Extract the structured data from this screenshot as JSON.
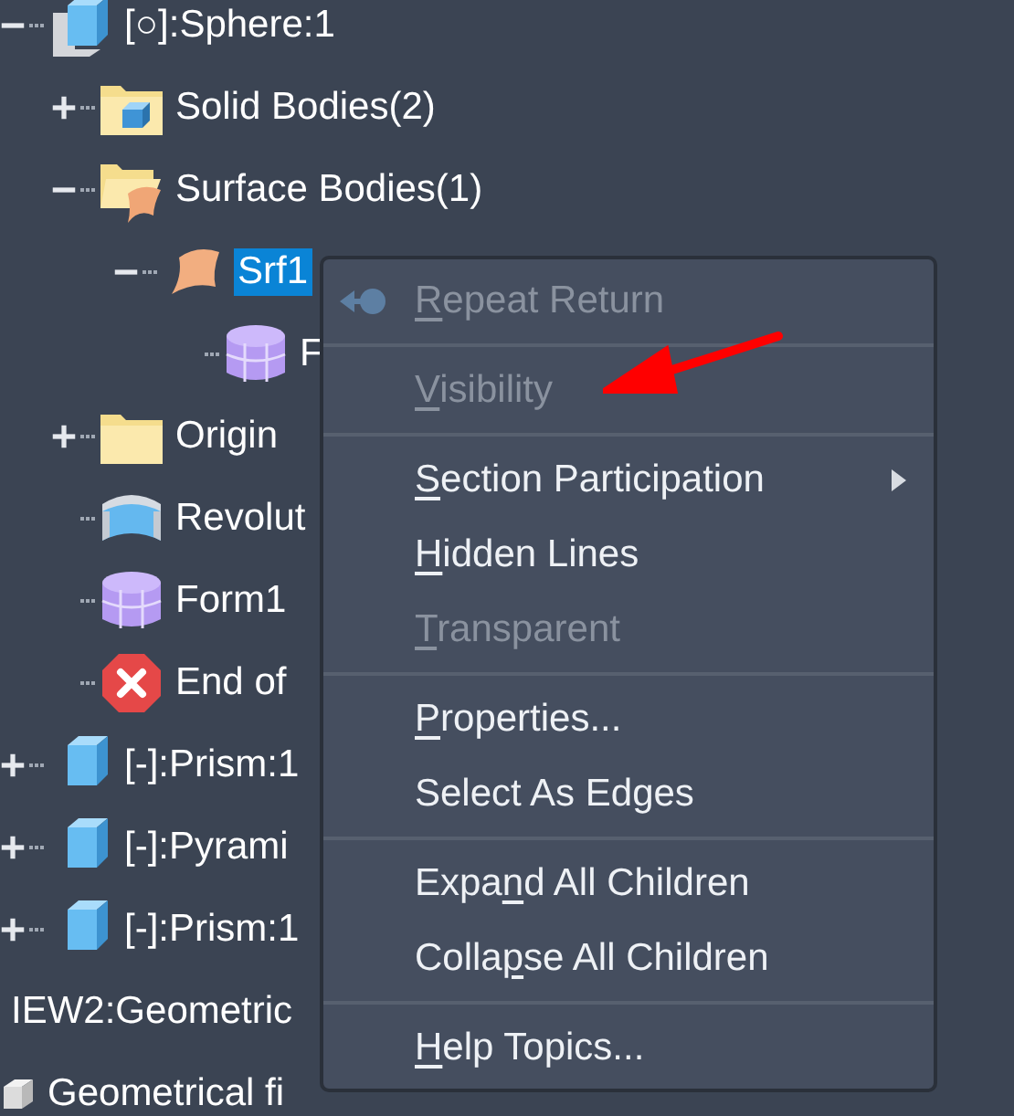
{
  "tree": [
    {
      "label": "[○]:Sphere:1",
      "kind": "cube-white",
      "expanded": true,
      "selected": false,
      "children": [
        {
          "label": "Solid Bodies(2)",
          "kind": "folder-cube",
          "expanded": false,
          "selected": false
        },
        {
          "label": "Surface Bodies(1)",
          "kind": "folder-surface",
          "expanded": true,
          "selected": false,
          "children": [
            {
              "label": "Srf1",
              "kind": "surface",
              "expanded": true,
              "selected": true,
              "children": [
                {
                  "label": "F",
                  "kind": "form",
                  "selected": false
                }
              ]
            }
          ]
        },
        {
          "label": "Origin",
          "kind": "folder",
          "expanded": false,
          "selected": false
        },
        {
          "label": "Revolut",
          "kind": "revolve",
          "selected": false
        },
        {
          "label": "Form1",
          "kind": "form",
          "selected": false
        },
        {
          "label": "End of",
          "kind": "error",
          "selected": false
        }
      ]
    },
    {
      "label": "[-]:Prism:1",
      "kind": "cube",
      "expanded": false,
      "selected": false
    },
    {
      "label": "[-]:Pyrami",
      "kind": "cube",
      "expanded": false,
      "selected": false
    },
    {
      "label": "[-]:Prism:1",
      "kind": "cube",
      "expanded": false,
      "selected": false
    },
    {
      "label": "IEW2:Geometric",
      "kind": "group",
      "selected": false
    },
    {
      "label": "Geometrical fi",
      "kind": "part",
      "selected": false
    }
  ],
  "context_menu": [
    {
      "kind": "repeat",
      "label": {
        "key": "R",
        "after": "epeat Return"
      },
      "disabled": true,
      "submenu": false
    },
    {
      "kind": "separator"
    },
    {
      "kind": "item",
      "label": {
        "key": "V",
        "after": "isibility"
      },
      "disabled": true,
      "submenu": false
    },
    {
      "kind": "separator"
    },
    {
      "kind": "item",
      "label": {
        "key": "S",
        "after": "ection Participation"
      },
      "disabled": false,
      "submenu": true
    },
    {
      "kind": "item",
      "label": {
        "key": "H",
        "after": "idden Lines"
      },
      "disabled": false,
      "submenu": false
    },
    {
      "kind": "item",
      "label": {
        "key": "T",
        "after": "ransparent"
      },
      "disabled": true,
      "submenu": false
    },
    {
      "kind": "separator"
    },
    {
      "kind": "item",
      "label": {
        "key": "P",
        "after": "roperties..."
      },
      "disabled": false,
      "submenu": false
    },
    {
      "kind": "item",
      "label": {
        "before": "Select As Edges"
      },
      "disabled": false,
      "submenu": false
    },
    {
      "kind": "separator"
    },
    {
      "kind": "item",
      "label": {
        "before": "Expa",
        "key": "n",
        "after": "d All Children"
      },
      "disabled": false,
      "submenu": false
    },
    {
      "kind": "item",
      "label": {
        "before": "Colla",
        "key": "p",
        "after": "se All Children"
      },
      "disabled": false,
      "submenu": false
    },
    {
      "kind": "separator"
    },
    {
      "kind": "item",
      "label": {
        "key": "H",
        "after": "elp Topics..."
      },
      "disabled": false,
      "submenu": false
    }
  ]
}
